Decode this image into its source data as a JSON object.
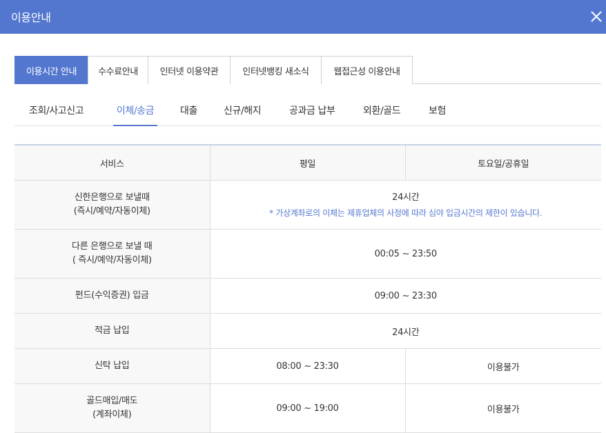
{
  "header": {
    "title": "이용안내"
  },
  "main_tabs": [
    {
      "label": "이용시간 안내"
    },
    {
      "label": "수수료안내"
    },
    {
      "label": "인터넷 이용약관"
    },
    {
      "label": "인터넷뱅킹 새소식"
    },
    {
      "label": "웹접근성 이용안내"
    }
  ],
  "sub_tabs": [
    {
      "label": "조회/사고신고"
    },
    {
      "label": "이체/송금"
    },
    {
      "label": "대출"
    },
    {
      "label": "신규/해지"
    },
    {
      "label": "공과금 납부"
    },
    {
      "label": "외환/골드"
    },
    {
      "label": "보험"
    }
  ],
  "table": {
    "headers": [
      "서비스",
      "평일",
      "토요일/공휴일"
    ],
    "rows": [
      {
        "service": [
          "신한은행으로 보낼때",
          "(즉시/예약/자동이체)"
        ],
        "all": "24시간",
        "note": "* 가상계좌로의 이체는 제휴업체의 사정에 따라 심야 입금시간의 제한이 있습니다."
      },
      {
        "service": [
          "다른 은행으로 보낼 때",
          "( 즉시/예약/자동이체)"
        ],
        "all": "00:05 ~ 23:50"
      },
      {
        "service": [
          "펀드(수익증권) 입금"
        ],
        "all": "09:00 ~ 23:30"
      },
      {
        "service": [
          "적금 납입"
        ],
        "all": "24시간"
      },
      {
        "service": [
          "신탁 납입"
        ],
        "weekday": "08:00 ~ 23:30",
        "weekend": "이용불가"
      },
      {
        "service": [
          "골드매입/매도",
          "(계좌이체)"
        ],
        "weekday": "09:00 ~ 19:00",
        "weekend": "이용불가"
      }
    ]
  }
}
